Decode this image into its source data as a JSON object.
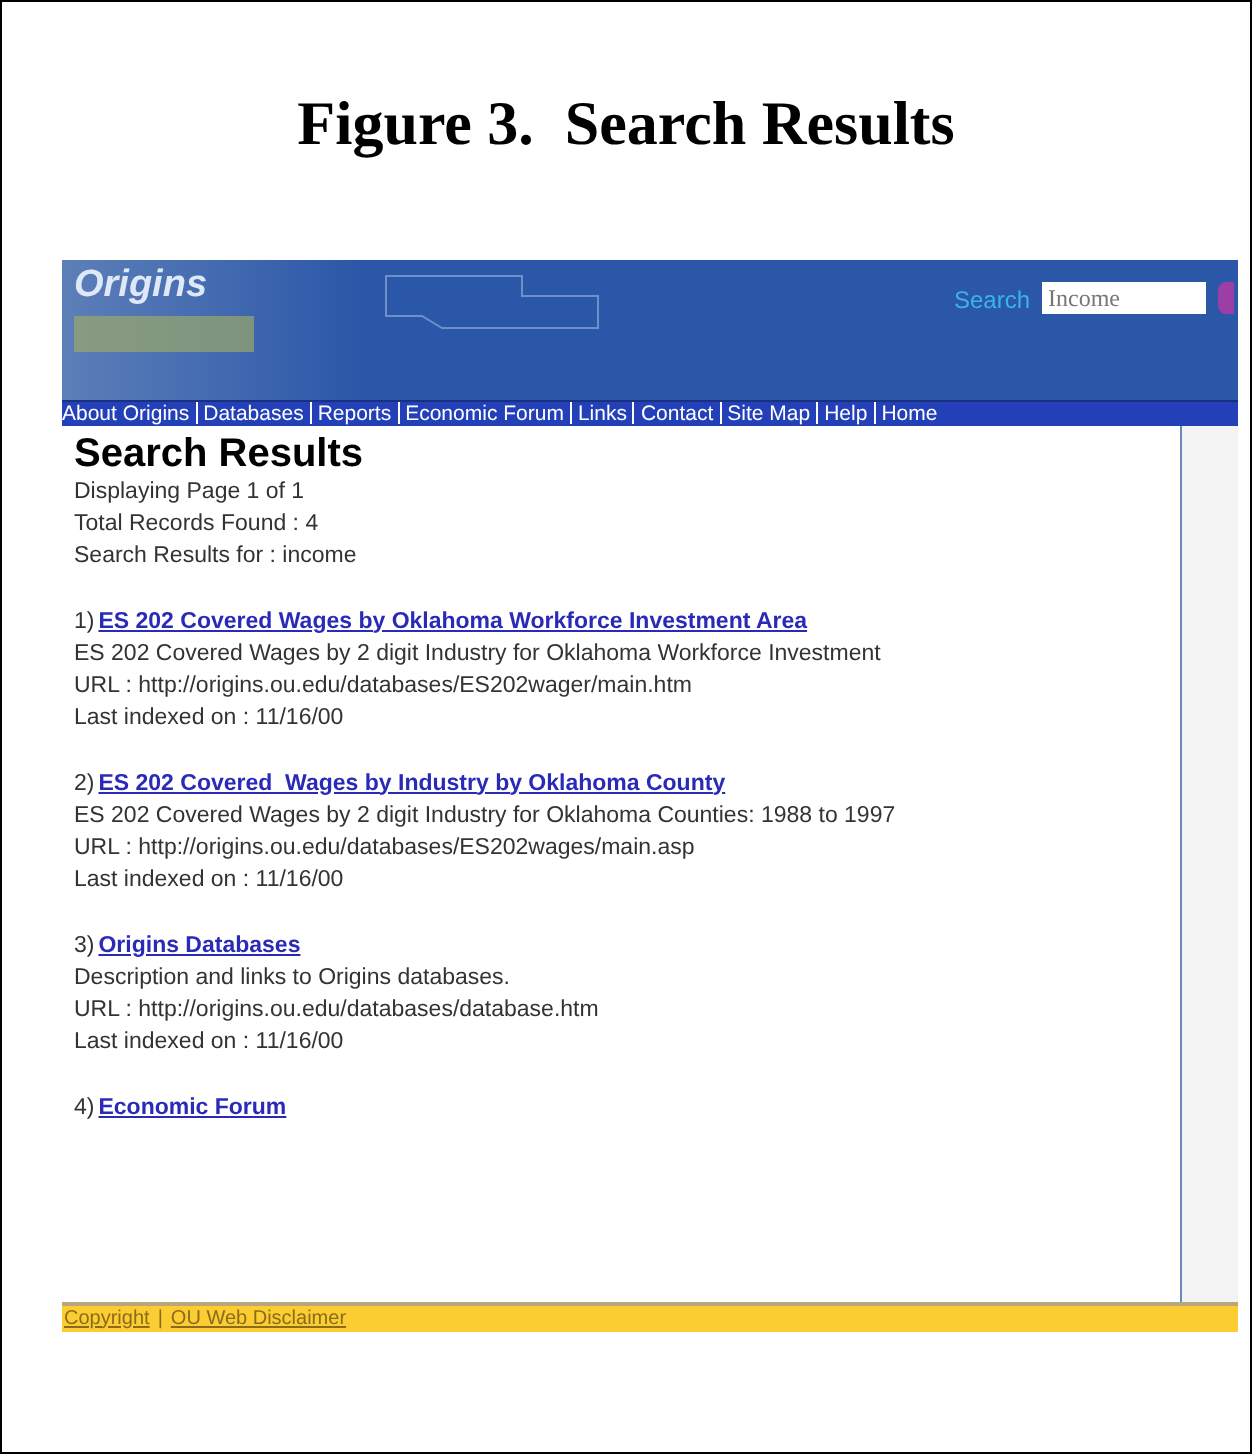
{
  "figure_title": "Figure 3.  Search Results",
  "header": {
    "logo": "Origins",
    "search_label": "Search",
    "search_value": "Income"
  },
  "nav": [
    "About Origins",
    "Databases",
    "Reports",
    "Economic Forum",
    "Links",
    "Contact",
    "Site Map",
    "Help",
    "Home"
  ],
  "page_title": "Search Results",
  "summary": [
    "Displaying Page 1 of 1",
    "Total Records Found : 4",
    "Search Results for : income"
  ],
  "results": [
    {
      "number": "1)",
      "title": "ES 202 Covered Wages by Oklahoma Workforce Investment Area",
      "description": "ES 202 Covered Wages by 2 digit Industry for Oklahoma Workforce Investment",
      "url": "URL : http://origins.ou.edu/databases/ES202wager/main.htm",
      "indexed": "Last indexed on : 11/16/00"
    },
    {
      "number": "2)",
      "title": "ES 202 Covered  Wages by Industry by Oklahoma County",
      "description": "ES 202 Covered Wages by 2 digit Industry for Oklahoma Counties: 1988 to 1997",
      "url": "URL : http://origins.ou.edu/databases/ES202wages/main.asp",
      "indexed": "Last indexed on : 11/16/00"
    },
    {
      "number": "3)",
      "title": "Origins Databases",
      "description": "Description and links to Origins databases.",
      "url": "URL : http://origins.ou.edu/databases/database.htm",
      "indexed": "Last indexed on : 11/16/00"
    },
    {
      "number": "4)",
      "title": "Economic Forum"
    }
  ],
  "footer": {
    "links": [
      "Copyright",
      "OU Web Disclaimer"
    ],
    "separator": "|"
  }
}
